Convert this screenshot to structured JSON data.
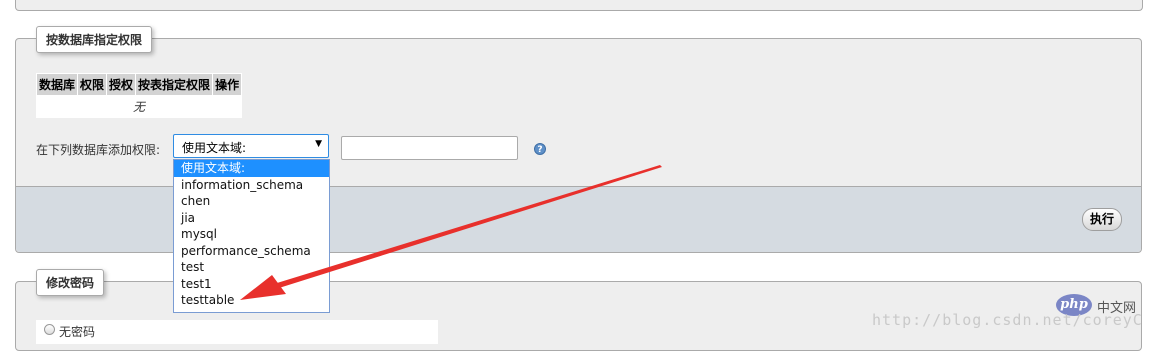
{
  "db_privileges": {
    "legend": "按数据库指定权限",
    "table_headers": [
      "数据库",
      "权限",
      "授权",
      "按表指定权限",
      "操作"
    ],
    "empty_text": "无",
    "add_label": "在下列数据库添加权限:",
    "select_value": "使用文本域:",
    "text_input_value": "",
    "dropdown_options": [
      "使用文本域:",
      "information_schema",
      "chen",
      "jia",
      "mysql",
      "performance_schema",
      "test",
      "test1",
      "testtable"
    ],
    "selected_option": "使用文本域:",
    "execute_button": "执行"
  },
  "change_password": {
    "legend": "修改密码",
    "no_password_label": "无密码"
  },
  "watermark": {
    "logo_text": "php",
    "site_text": "中文网",
    "url_text": "http://blog.csdn.net/coreyC"
  },
  "colors": {
    "annotation_arrow": "#e8302c",
    "selected_option_bg": "#1e90ff",
    "footer_bar": "#d5dbe1"
  }
}
